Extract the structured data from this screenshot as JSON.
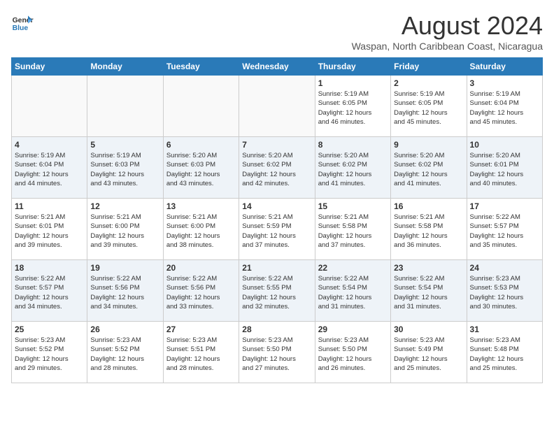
{
  "logo": {
    "line1": "General",
    "line2": "Blue"
  },
  "title": "August 2024",
  "location": "Waspan, North Caribbean Coast, Nicaragua",
  "days_of_week": [
    "Sunday",
    "Monday",
    "Tuesday",
    "Wednesday",
    "Thursday",
    "Friday",
    "Saturday"
  ],
  "weeks": [
    [
      {
        "day": "",
        "info": ""
      },
      {
        "day": "",
        "info": ""
      },
      {
        "day": "",
        "info": ""
      },
      {
        "day": "",
        "info": ""
      },
      {
        "day": "1",
        "info": "Sunrise: 5:19 AM\nSunset: 6:05 PM\nDaylight: 12 hours\nand 46 minutes."
      },
      {
        "day": "2",
        "info": "Sunrise: 5:19 AM\nSunset: 6:05 PM\nDaylight: 12 hours\nand 45 minutes."
      },
      {
        "day": "3",
        "info": "Sunrise: 5:19 AM\nSunset: 6:04 PM\nDaylight: 12 hours\nand 45 minutes."
      }
    ],
    [
      {
        "day": "4",
        "info": "Sunrise: 5:19 AM\nSunset: 6:04 PM\nDaylight: 12 hours\nand 44 minutes."
      },
      {
        "day": "5",
        "info": "Sunrise: 5:19 AM\nSunset: 6:03 PM\nDaylight: 12 hours\nand 43 minutes."
      },
      {
        "day": "6",
        "info": "Sunrise: 5:20 AM\nSunset: 6:03 PM\nDaylight: 12 hours\nand 43 minutes."
      },
      {
        "day": "7",
        "info": "Sunrise: 5:20 AM\nSunset: 6:02 PM\nDaylight: 12 hours\nand 42 minutes."
      },
      {
        "day": "8",
        "info": "Sunrise: 5:20 AM\nSunset: 6:02 PM\nDaylight: 12 hours\nand 41 minutes."
      },
      {
        "day": "9",
        "info": "Sunrise: 5:20 AM\nSunset: 6:02 PM\nDaylight: 12 hours\nand 41 minutes."
      },
      {
        "day": "10",
        "info": "Sunrise: 5:20 AM\nSunset: 6:01 PM\nDaylight: 12 hours\nand 40 minutes."
      }
    ],
    [
      {
        "day": "11",
        "info": "Sunrise: 5:21 AM\nSunset: 6:01 PM\nDaylight: 12 hours\nand 39 minutes."
      },
      {
        "day": "12",
        "info": "Sunrise: 5:21 AM\nSunset: 6:00 PM\nDaylight: 12 hours\nand 39 minutes."
      },
      {
        "day": "13",
        "info": "Sunrise: 5:21 AM\nSunset: 6:00 PM\nDaylight: 12 hours\nand 38 minutes."
      },
      {
        "day": "14",
        "info": "Sunrise: 5:21 AM\nSunset: 5:59 PM\nDaylight: 12 hours\nand 37 minutes."
      },
      {
        "day": "15",
        "info": "Sunrise: 5:21 AM\nSunset: 5:58 PM\nDaylight: 12 hours\nand 37 minutes."
      },
      {
        "day": "16",
        "info": "Sunrise: 5:21 AM\nSunset: 5:58 PM\nDaylight: 12 hours\nand 36 minutes."
      },
      {
        "day": "17",
        "info": "Sunrise: 5:22 AM\nSunset: 5:57 PM\nDaylight: 12 hours\nand 35 minutes."
      }
    ],
    [
      {
        "day": "18",
        "info": "Sunrise: 5:22 AM\nSunset: 5:57 PM\nDaylight: 12 hours\nand 34 minutes."
      },
      {
        "day": "19",
        "info": "Sunrise: 5:22 AM\nSunset: 5:56 PM\nDaylight: 12 hours\nand 34 minutes."
      },
      {
        "day": "20",
        "info": "Sunrise: 5:22 AM\nSunset: 5:56 PM\nDaylight: 12 hours\nand 33 minutes."
      },
      {
        "day": "21",
        "info": "Sunrise: 5:22 AM\nSunset: 5:55 PM\nDaylight: 12 hours\nand 32 minutes."
      },
      {
        "day": "22",
        "info": "Sunrise: 5:22 AM\nSunset: 5:54 PM\nDaylight: 12 hours\nand 31 minutes."
      },
      {
        "day": "23",
        "info": "Sunrise: 5:22 AM\nSunset: 5:54 PM\nDaylight: 12 hours\nand 31 minutes."
      },
      {
        "day": "24",
        "info": "Sunrise: 5:23 AM\nSunset: 5:53 PM\nDaylight: 12 hours\nand 30 minutes."
      }
    ],
    [
      {
        "day": "25",
        "info": "Sunrise: 5:23 AM\nSunset: 5:52 PM\nDaylight: 12 hours\nand 29 minutes."
      },
      {
        "day": "26",
        "info": "Sunrise: 5:23 AM\nSunset: 5:52 PM\nDaylight: 12 hours\nand 28 minutes."
      },
      {
        "day": "27",
        "info": "Sunrise: 5:23 AM\nSunset: 5:51 PM\nDaylight: 12 hours\nand 28 minutes."
      },
      {
        "day": "28",
        "info": "Sunrise: 5:23 AM\nSunset: 5:50 PM\nDaylight: 12 hours\nand 27 minutes."
      },
      {
        "day": "29",
        "info": "Sunrise: 5:23 AM\nSunset: 5:50 PM\nDaylight: 12 hours\nand 26 minutes."
      },
      {
        "day": "30",
        "info": "Sunrise: 5:23 AM\nSunset: 5:49 PM\nDaylight: 12 hours\nand 25 minutes."
      },
      {
        "day": "31",
        "info": "Sunrise: 5:23 AM\nSunset: 5:48 PM\nDaylight: 12 hours\nand 25 minutes."
      }
    ]
  ]
}
